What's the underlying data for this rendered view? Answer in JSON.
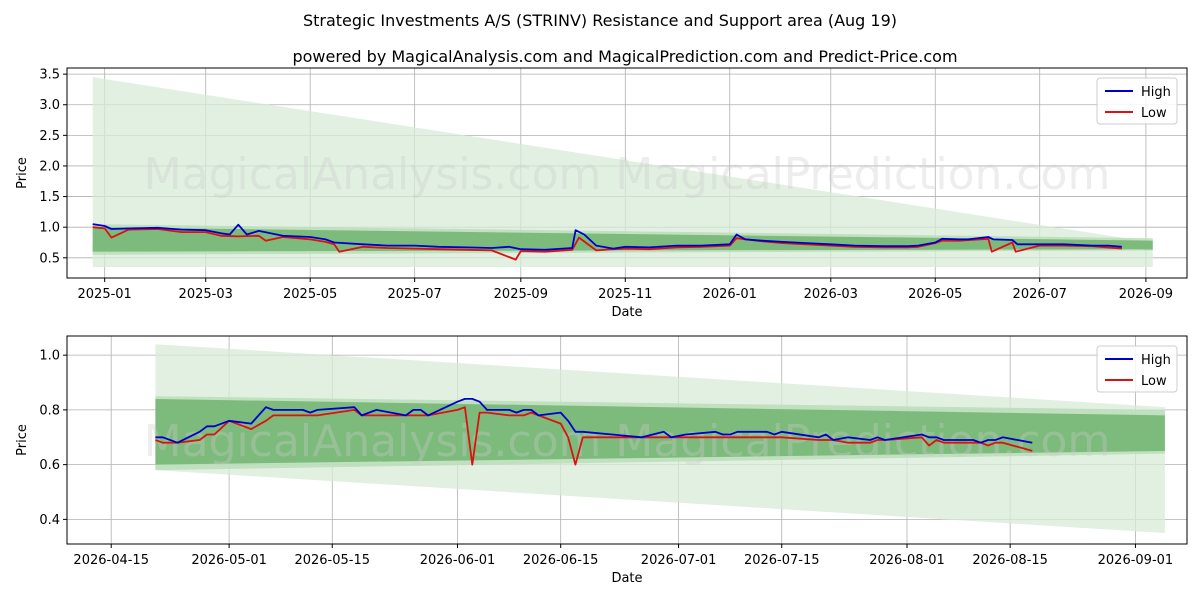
{
  "figure": {
    "title": "Strategic Investments A/S (STRINV) Resistance and Support area (Aug 19)",
    "subtitle": "powered by MagicalAnalysis.com and MagicalPrediction.com and Predict-Price.com",
    "watermark": "MagicalAnalysis.com   MagicalPrediction.com"
  },
  "colors": {
    "high": "#0000cc",
    "low": "#dd1111",
    "band_dark": "#6ab26a",
    "band_light": "#b8dcb8",
    "wedge": "#d7ebd7",
    "grid": "#b0b0b0"
  },
  "chart_data": [
    {
      "type": "line",
      "xlabel": "Date",
      "ylabel": "Price",
      "xlim": [
        "2024-12-10",
        "2026-09-25"
      ],
      "ylim": [
        0.17,
        3.6
      ],
      "yticks": [
        0.5,
        1.0,
        1.5,
        2.0,
        2.5,
        3.0,
        3.5
      ],
      "ytick_labels": [
        "0.5",
        "1.0",
        "1.5",
        "2.0",
        "2.5",
        "3.0",
        "3.5"
      ],
      "xticks": [
        "2025-01-01",
        "2025-03-01",
        "2025-05-01",
        "2025-07-01",
        "2025-09-01",
        "2025-11-01",
        "2026-01-01",
        "2026-03-01",
        "2026-05-01",
        "2026-07-01",
        "2026-09-01"
      ],
      "xtick_labels": [
        "2025-01",
        "2025-03",
        "2025-05",
        "2025-07",
        "2025-09",
        "2025-11",
        "2026-01",
        "2026-03",
        "2026-05",
        "2026-07",
        "2026-09"
      ],
      "grid": true,
      "legend": "top-right",
      "support_resistance": {
        "start": "2024-12-25",
        "end": "2026-09-05",
        "wedge_start": [
          0.35,
          3.45
        ],
        "wedge_end": [
          0.35,
          0.75
        ],
        "outer_start": [
          0.55,
          1.05
        ],
        "outer_end": [
          0.62,
          0.82
        ],
        "inner_start": [
          0.6,
          1.0
        ],
        "inner_end": [
          0.64,
          0.78
        ]
      },
      "series": [
        {
          "name": "High",
          "x": [
            "2024-12-25",
            "2025-01-01",
            "2025-01-05",
            "2025-01-15",
            "2025-02-01",
            "2025-02-15",
            "2025-03-01",
            "2025-03-10",
            "2025-03-15",
            "2025-03-20",
            "2025-03-25",
            "2025-04-01",
            "2025-04-15",
            "2025-05-01",
            "2025-05-10",
            "2025-05-15",
            "2025-06-01",
            "2025-06-15",
            "2025-07-01",
            "2025-07-15",
            "2025-08-01",
            "2025-08-15",
            "2025-08-25",
            "2025-09-01",
            "2025-09-15",
            "2025-10-01",
            "2025-10-03",
            "2025-10-08",
            "2025-10-15",
            "2025-10-25",
            "2025-11-01",
            "2025-11-15",
            "2025-12-01",
            "2025-12-15",
            "2026-01-01",
            "2026-01-05",
            "2026-01-10",
            "2026-01-20",
            "2026-02-01",
            "2026-02-15",
            "2026-03-01",
            "2026-03-15",
            "2026-04-01",
            "2026-04-15",
            "2026-04-21",
            "2026-05-01",
            "2026-05-05",
            "2026-05-15",
            "2026-05-20",
            "2026-06-01",
            "2026-06-04",
            "2026-06-15",
            "2026-06-18",
            "2026-07-01",
            "2026-07-15",
            "2026-08-01",
            "2026-08-10",
            "2026-08-18"
          ],
          "values": [
            1.05,
            1.02,
            0.97,
            0.98,
            0.99,
            0.96,
            0.95,
            0.9,
            0.88,
            1.04,
            0.88,
            0.94,
            0.86,
            0.84,
            0.8,
            0.75,
            0.72,
            0.7,
            0.7,
            0.68,
            0.67,
            0.66,
            0.68,
            0.64,
            0.63,
            0.66,
            0.95,
            0.88,
            0.7,
            0.65,
            0.68,
            0.67,
            0.7,
            0.7,
            0.72,
            0.88,
            0.8,
            0.78,
            0.76,
            0.74,
            0.72,
            0.7,
            0.69,
            0.69,
            0.7,
            0.75,
            0.81,
            0.8,
            0.8,
            0.84,
            0.8,
            0.79,
            0.72,
            0.72,
            0.72,
            0.7,
            0.7,
            0.68
          ]
        },
        {
          "name": "Low",
          "x": [
            "2024-12-25",
            "2025-01-01",
            "2025-01-05",
            "2025-01-15",
            "2025-02-01",
            "2025-02-15",
            "2025-03-01",
            "2025-03-10",
            "2025-03-20",
            "2025-04-01",
            "2025-04-05",
            "2025-04-15",
            "2025-05-01",
            "2025-05-10",
            "2025-05-15",
            "2025-05-18",
            "2025-06-01",
            "2025-06-15",
            "2025-07-01",
            "2025-07-15",
            "2025-08-01",
            "2025-08-15",
            "2025-08-29",
            "2025-09-01",
            "2025-09-15",
            "2025-10-01",
            "2025-10-05",
            "2025-10-15",
            "2025-10-25",
            "2025-11-01",
            "2025-11-15",
            "2025-12-01",
            "2025-12-15",
            "2026-01-01",
            "2026-01-05",
            "2026-01-20",
            "2026-02-01",
            "2026-02-15",
            "2026-03-01",
            "2026-03-15",
            "2026-04-01",
            "2026-04-15",
            "2026-04-21",
            "2026-05-01",
            "2026-05-05",
            "2026-05-15",
            "2026-06-01",
            "2026-06-03",
            "2026-06-15",
            "2026-06-17",
            "2026-07-01",
            "2026-07-15",
            "2026-08-01",
            "2026-08-18"
          ],
          "values": [
            1.0,
            0.98,
            0.83,
            0.96,
            0.97,
            0.92,
            0.92,
            0.86,
            0.85,
            0.86,
            0.78,
            0.84,
            0.8,
            0.76,
            0.72,
            0.6,
            0.68,
            0.66,
            0.65,
            0.64,
            0.63,
            0.62,
            0.47,
            0.61,
            0.6,
            0.63,
            0.83,
            0.62,
            0.64,
            0.65,
            0.64,
            0.67,
            0.68,
            0.7,
            0.82,
            0.77,
            0.74,
            0.72,
            0.7,
            0.68,
            0.67,
            0.67,
            0.68,
            0.74,
            0.78,
            0.78,
            0.81,
            0.6,
            0.75,
            0.6,
            0.7,
            0.7,
            0.69,
            0.65
          ]
        }
      ]
    },
    {
      "type": "line",
      "xlabel": "Date",
      "ylabel": "Price",
      "xlim": [
        "2026-04-09",
        "2026-09-08"
      ],
      "ylim": [
        0.31,
        1.07
      ],
      "yticks": [
        0.4,
        0.6,
        0.8,
        1.0
      ],
      "ytick_labels": [
        "0.4",
        "0.6",
        "0.8",
        "1.0"
      ],
      "xticks": [
        "2026-04-15",
        "2026-05-01",
        "2026-05-15",
        "2026-06-01",
        "2026-06-15",
        "2026-07-01",
        "2026-07-15",
        "2026-08-01",
        "2026-08-15",
        "2026-09-01"
      ],
      "xtick_labels": [
        "2026-04-15",
        "2026-05-01",
        "2026-05-15",
        "2026-06-01",
        "2026-06-15",
        "2026-07-01",
        "2026-07-15",
        "2026-08-01",
        "2026-08-15",
        "2026-09-01"
      ],
      "grid": true,
      "legend": "top-right",
      "support_resistance": {
        "start": "2026-04-21",
        "end": "2026-09-05",
        "wedge_start": [
          0.58,
          1.04
        ],
        "wedge_end": [
          0.35,
          0.81
        ],
        "outer_start": [
          0.58,
          0.85
        ],
        "outer_end": [
          0.64,
          0.8
        ],
        "inner_start": [
          0.6,
          0.84
        ],
        "inner_end": [
          0.65,
          0.78
        ]
      },
      "series": [
        {
          "name": "High",
          "x": [
            "2026-04-21",
            "2026-04-22",
            "2026-04-24",
            "2026-04-27",
            "2026-04-28",
            "2026-04-29",
            "2026-05-01",
            "2026-05-04",
            "2026-05-06",
            "2026-05-07",
            "2026-05-08",
            "2026-05-11",
            "2026-05-12",
            "2026-05-13",
            "2026-05-18",
            "2026-05-19",
            "2026-05-21",
            "2026-05-25",
            "2026-05-26",
            "2026-05-27",
            "2026-05-28",
            "2026-06-01",
            "2026-06-02",
            "2026-06-03",
            "2026-06-04",
            "2026-06-05",
            "2026-06-08",
            "2026-06-09",
            "2026-06-10",
            "2026-06-11",
            "2026-06-12",
            "2026-06-15",
            "2026-06-16",
            "2026-06-17",
            "2026-06-18",
            "2026-06-22",
            "2026-06-26",
            "2026-06-29",
            "2026-06-30",
            "2026-07-02",
            "2026-07-06",
            "2026-07-07",
            "2026-07-08",
            "2026-07-09",
            "2026-07-13",
            "2026-07-14",
            "2026-07-15",
            "2026-07-20",
            "2026-07-21",
            "2026-07-22",
            "2026-07-24",
            "2026-07-27",
            "2026-07-28",
            "2026-07-29",
            "2026-08-03",
            "2026-08-04",
            "2026-08-05",
            "2026-08-06",
            "2026-08-10",
            "2026-08-11",
            "2026-08-12",
            "2026-08-13",
            "2026-08-14",
            "2026-08-18"
          ],
          "values": [
            0.7,
            0.7,
            0.68,
            0.72,
            0.74,
            0.74,
            0.76,
            0.75,
            0.81,
            0.8,
            0.8,
            0.8,
            0.79,
            0.8,
            0.81,
            0.78,
            0.8,
            0.78,
            0.8,
            0.8,
            0.78,
            0.83,
            0.84,
            0.84,
            0.83,
            0.8,
            0.8,
            0.79,
            0.8,
            0.8,
            0.78,
            0.79,
            0.76,
            0.72,
            0.72,
            0.71,
            0.7,
            0.72,
            0.7,
            0.71,
            0.72,
            0.71,
            0.71,
            0.72,
            0.72,
            0.71,
            0.72,
            0.7,
            0.71,
            0.69,
            0.7,
            0.69,
            0.7,
            0.69,
            0.71,
            0.7,
            0.7,
            0.69,
            0.69,
            0.68,
            0.69,
            0.69,
            0.7,
            0.68
          ]
        },
        {
          "name": "Low",
          "x": [
            "2026-04-21",
            "2026-04-22",
            "2026-04-24",
            "2026-04-27",
            "2026-04-28",
            "2026-04-29",
            "2026-05-01",
            "2026-05-04",
            "2026-05-06",
            "2026-05-07",
            "2026-05-08",
            "2026-05-11",
            "2026-05-12",
            "2026-05-13",
            "2026-05-18",
            "2026-05-19",
            "2026-05-21",
            "2026-05-25",
            "2026-05-26",
            "2026-05-27",
            "2026-05-28",
            "2026-06-01",
            "2026-06-02",
            "2026-06-03",
            "2026-06-04",
            "2026-06-05",
            "2026-06-08",
            "2026-06-09",
            "2026-06-10",
            "2026-06-11",
            "2026-06-12",
            "2026-06-15",
            "2026-06-16",
            "2026-06-17",
            "2026-06-18",
            "2026-06-22",
            "2026-06-26",
            "2026-06-29",
            "2026-06-30",
            "2026-07-02",
            "2026-07-06",
            "2026-07-07",
            "2026-07-08",
            "2026-07-09",
            "2026-07-13",
            "2026-07-14",
            "2026-07-15",
            "2026-07-20",
            "2026-07-21",
            "2026-07-22",
            "2026-07-24",
            "2026-07-27",
            "2026-07-28",
            "2026-07-29",
            "2026-08-03",
            "2026-08-04",
            "2026-08-05",
            "2026-08-06",
            "2026-08-10",
            "2026-08-11",
            "2026-08-12",
            "2026-08-13",
            "2026-08-14",
            "2026-08-18"
          ],
          "values": [
            0.69,
            0.68,
            0.68,
            0.69,
            0.71,
            0.71,
            0.76,
            0.73,
            0.76,
            0.78,
            0.78,
            0.78,
            0.78,
            0.78,
            0.8,
            0.78,
            0.78,
            0.78,
            0.78,
            0.78,
            0.78,
            0.8,
            0.81,
            0.6,
            0.79,
            0.79,
            0.78,
            0.78,
            0.78,
            0.79,
            0.78,
            0.75,
            0.7,
            0.6,
            0.7,
            0.7,
            0.7,
            0.7,
            0.7,
            0.7,
            0.7,
            0.7,
            0.7,
            0.7,
            0.7,
            0.7,
            0.7,
            0.69,
            0.69,
            0.69,
            0.68,
            0.68,
            0.69,
            0.69,
            0.7,
            0.67,
            0.69,
            0.68,
            0.68,
            0.68,
            0.67,
            0.68,
            0.68,
            0.65
          ]
        }
      ]
    }
  ]
}
